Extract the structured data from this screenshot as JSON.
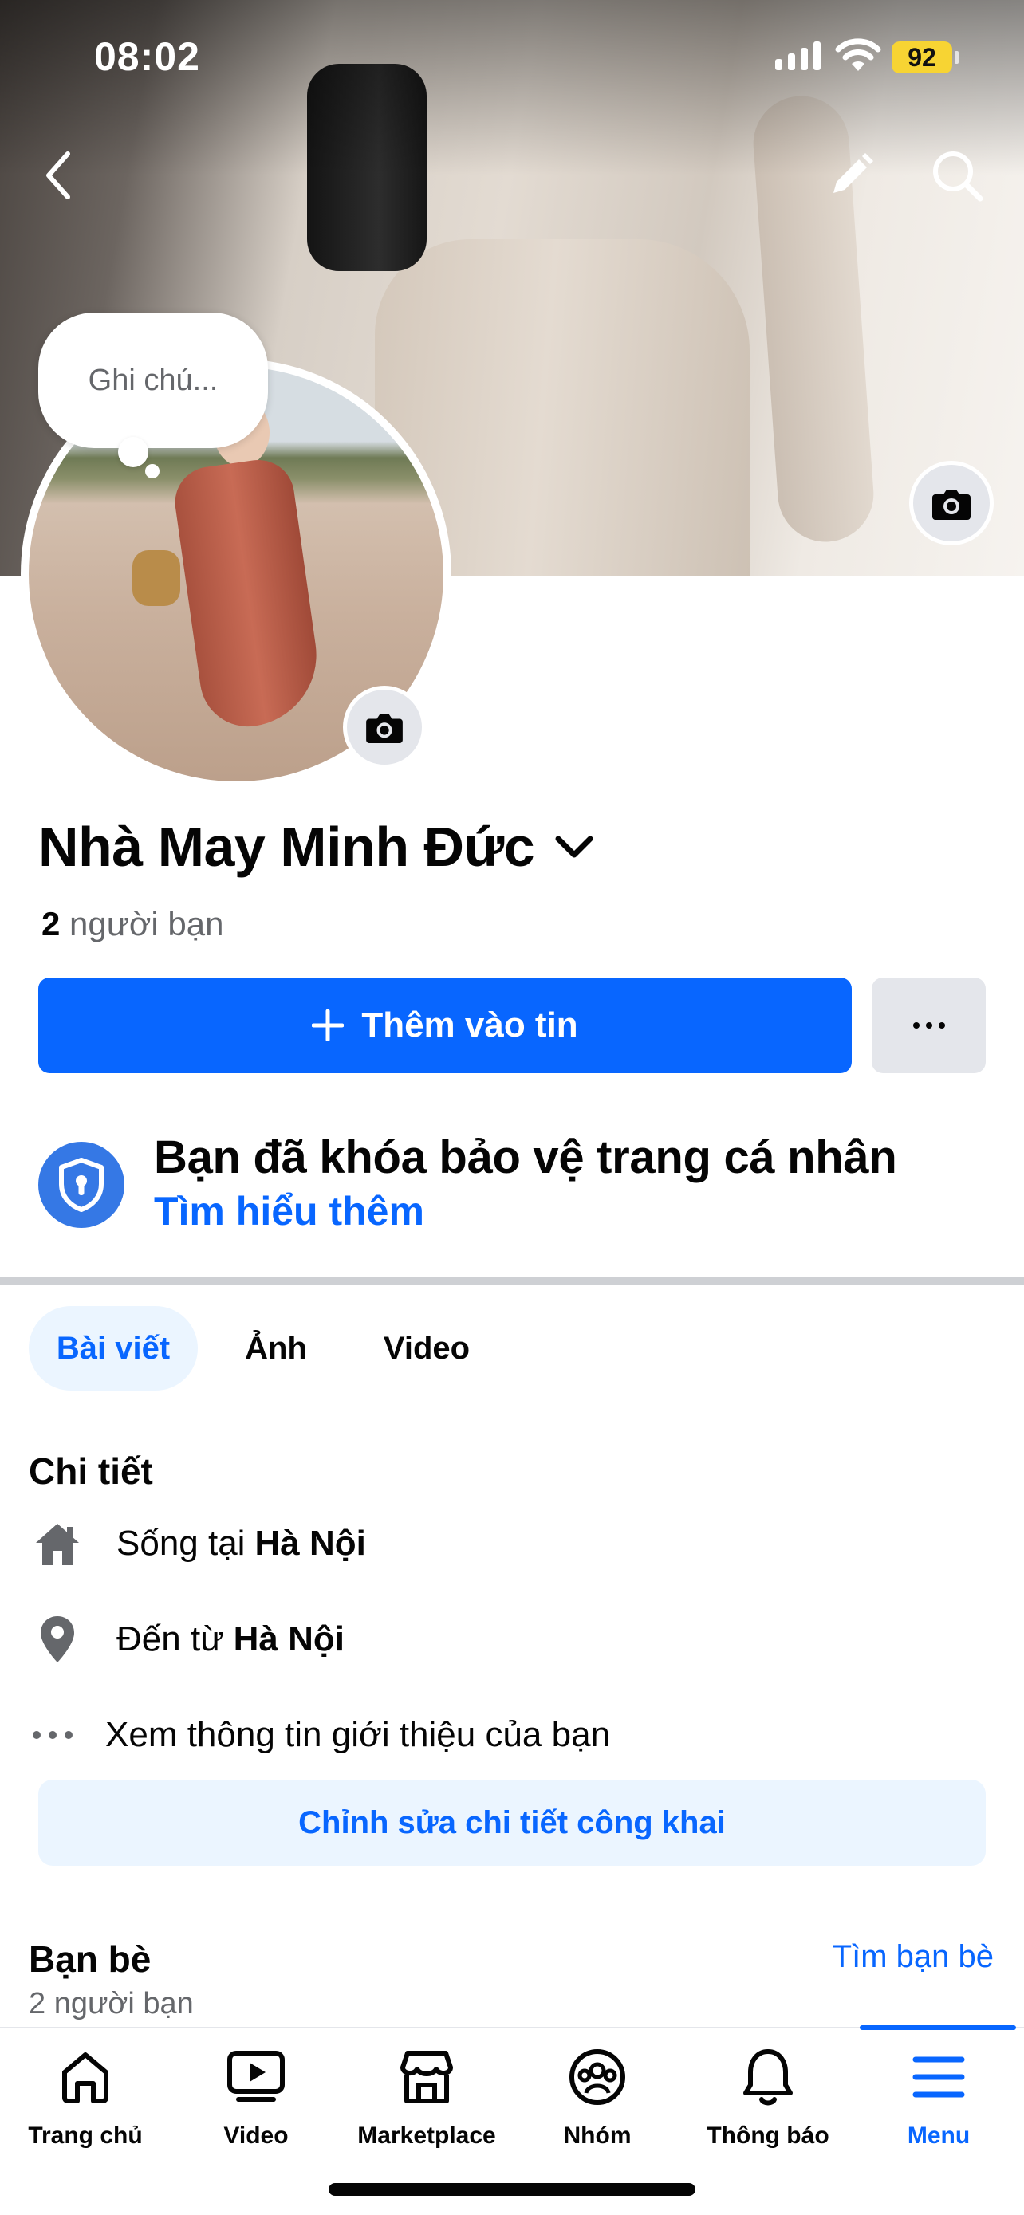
{
  "status_bar": {
    "time": "08:02",
    "battery": "92",
    "battery_color": "#f7d433"
  },
  "cover": {
    "icons": [
      "back-arrow-icon",
      "pencil-icon",
      "search-icon",
      "camera-icon"
    ]
  },
  "note": {
    "placeholder": "Ghi chú..."
  },
  "profile": {
    "name": "Nhà May Minh Đức",
    "friends_count": "2",
    "friends_suffix": "người bạn"
  },
  "actions": {
    "add_story": "Thêm vào tin",
    "more": "..."
  },
  "lock_notice": {
    "title": "Bạn đã khóa bảo vệ trang cá nhân",
    "link": "Tìm hiểu thêm"
  },
  "tabs": [
    {
      "label": "Bài viết",
      "active": true
    },
    {
      "label": "Ảnh",
      "active": false
    },
    {
      "label": "Video",
      "active": false
    }
  ],
  "details": {
    "title": "Chi tiết",
    "lives_prefix": "Sống tại",
    "lives_value": "Hà Nội",
    "from_prefix": "Đến từ",
    "from_value": "Hà Nội",
    "about": "Xem thông tin giới thiệu của bạn",
    "edit_public": "Chỉnh sửa chi tiết công khai"
  },
  "friends_section": {
    "title": "Bạn bè",
    "find": "Tìm bạn bè",
    "subtitle": "2 người bạn"
  },
  "tabbar": [
    {
      "label": "Trang chủ",
      "icon": "home-icon",
      "active": false
    },
    {
      "label": "Video",
      "icon": "video-icon",
      "active": false
    },
    {
      "label": "Marketplace",
      "icon": "marketplace-icon",
      "active": false
    },
    {
      "label": "Nhóm",
      "icon": "groups-icon",
      "active": false
    },
    {
      "label": "Thông báo",
      "icon": "bell-icon",
      "active": false
    },
    {
      "label": "Menu",
      "icon": "menu-icon",
      "active": true
    }
  ],
  "colors": {
    "accent": "#0866ff",
    "accent_light": "#ebf5ff",
    "secondary_text": "#65676b",
    "button_gray": "#e4e6eb"
  }
}
